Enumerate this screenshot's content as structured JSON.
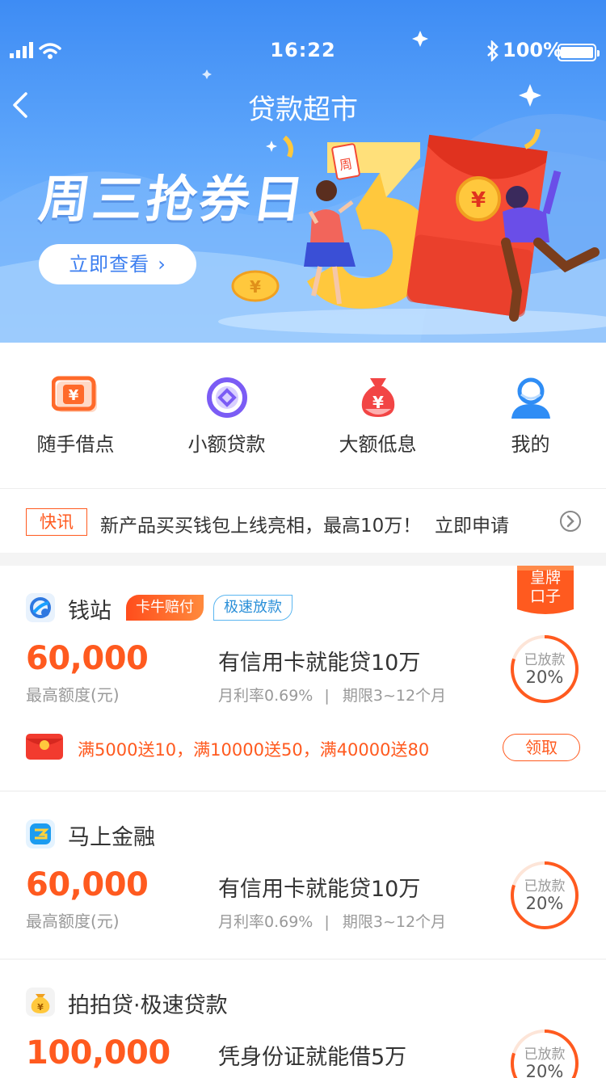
{
  "status_bar": {
    "time": "16:22",
    "battery": "100%",
    "icons": [
      "signal-icon",
      "wifi-icon",
      "bluetooth-icon",
      "battery-icon"
    ]
  },
  "nav": {
    "title": "贷款超市",
    "back_icon": "chevron-left-icon"
  },
  "banner": {
    "title": "周三抢券日",
    "button_label": "立即查看",
    "button_arrow": "›",
    "tag_label": "周",
    "colors": {
      "sky": "#3e8cf4",
      "red_envelope": "#f44a35",
      "gold": "#ffc83d"
    }
  },
  "quick_entries": [
    {
      "label": "随手借点",
      "icon": "yuan-card-icon",
      "color": "#ff6a2a"
    },
    {
      "label": "小额贷款",
      "icon": "diamond-circle-icon",
      "color": "#7b5cf5"
    },
    {
      "label": "大额低息",
      "icon": "money-bag-icon",
      "color": "#f24545"
    },
    {
      "label": "我的",
      "icon": "user-icon",
      "color": "#2f8df5"
    }
  ],
  "news": {
    "tag": "快讯",
    "text": "新产品买买钱包上线亮相，最高10万！",
    "action": "立即申请",
    "arrow_icon": "chevron-right-circle-icon"
  },
  "loans": [
    {
      "name": "钱站",
      "icon": "qianzhan-logo-icon",
      "tags": [
        "卡牛赔付",
        "极速放款"
      ],
      "amount": "60,000",
      "amount_label": "最高额度(元)",
      "headline": "有信用卡就能贷10万",
      "rate": "月利率0.69%",
      "separator": "|",
      "term": "期限3~12个月",
      "ring_label": "已放款",
      "ring_value": "20%",
      "progress": 0.2,
      "ribbon": "皇牌\n口子",
      "promo": "满5000送10，满10000送50，满40000送80",
      "claim": "领取"
    },
    {
      "name": "马上金融",
      "icon": "mashang-logo-icon",
      "amount": "60,000",
      "amount_label": "最高额度(元)",
      "headline": "有信用卡就能贷10万",
      "rate": "月利率0.69%",
      "separator": "|",
      "term": "期限3~12个月",
      "ring_label": "已放款",
      "ring_value": "20%",
      "progress": 0.2
    },
    {
      "name": "拍拍贷·极速贷款",
      "icon": "paipaidai-logo-icon",
      "amount": "100,000",
      "headline": "凭身份证就能借5万",
      "ring_label": "已放款",
      "ring_value": "20%",
      "progress": 0.2
    }
  ],
  "accent": "#ff5a1f"
}
